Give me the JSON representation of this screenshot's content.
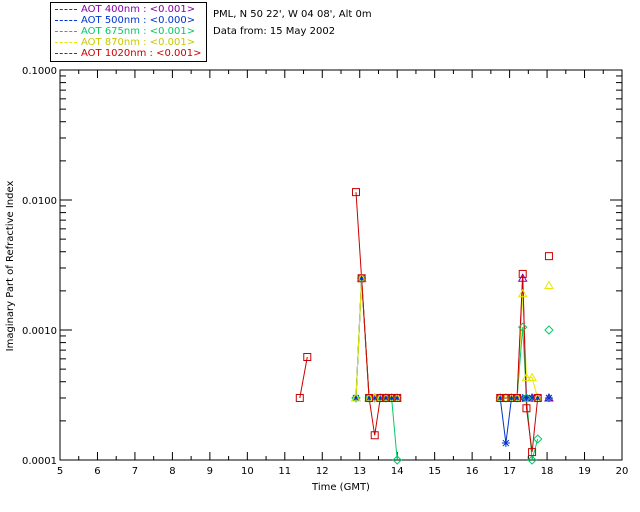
{
  "header": {
    "site": "PML, N 50 22', W 04 08', Alt 0m",
    "date": "Data from: 15 May 2002"
  },
  "legend": [
    {
      "label": "AOT  400nm : <0.001>",
      "color": "#8800aa"
    },
    {
      "label": "AOT  500nm : <0.000>",
      "color": "#0033cc"
    },
    {
      "label": "AOT  675nm : <0.001>",
      "color": "#00cc66"
    },
    {
      "label": "AOT  870nm : <0.001>",
      "color": "#e8e800"
    },
    {
      "label": "AOT 1020nm : <0.001>",
      "color": "#cc0000"
    }
  ],
  "chart_data": {
    "type": "line",
    "xlabel": "Time (GMT)",
    "ylabel": "Imaginary Part of Refractive Index",
    "xlim": [
      5,
      20
    ],
    "ylim": [
      0.0001,
      0.1
    ],
    "yscale": "log",
    "xticks": [
      5,
      6,
      7,
      8,
      9,
      10,
      11,
      12,
      13,
      14,
      15,
      16,
      17,
      18,
      19,
      20
    ],
    "yticks": [
      0.0001,
      0.001,
      0.01,
      0.1
    ],
    "ytick_labels": [
      "0.0001",
      "0.0010",
      "0.0100",
      "0.1000"
    ],
    "grid": false,
    "legend_position": "top-left, outside",
    "series": [
      {
        "name": "AOT  400nm : <0.001>",
        "color": "#8800aa",
        "marker": "triangle",
        "segments": [
          [
            [
              12.9,
              0.0003
            ],
            [
              13.05,
              0.0025
            ],
            [
              13.25,
              0.0003
            ],
            [
              13.4,
              0.0003
            ],
            [
              13.55,
              0.0003
            ],
            [
              13.7,
              0.0003
            ],
            [
              13.85,
              0.0003
            ],
            [
              14.0,
              0.0003
            ]
          ],
          [
            [
              16.75,
              0.0003
            ],
            [
              16.9,
              0.0003
            ],
            [
              17.05,
              0.0003
            ],
            [
              17.2,
              0.0003
            ],
            [
              17.35,
              0.0025
            ],
            [
              17.45,
              0.0003
            ],
            [
              17.6,
              0.0003
            ],
            [
              17.75,
              0.0003
            ]
          ]
        ],
        "points": [
          [
            18.05,
            0.0003
          ]
        ]
      },
      {
        "name": "AOT  500nm : <0.000>",
        "color": "#0033cc",
        "marker": "asterisk",
        "segments": [
          [
            [
              12.9,
              0.0003
            ],
            [
              13.05,
              0.0025
            ],
            [
              13.25,
              0.0003
            ],
            [
              13.4,
              0.0003
            ],
            [
              13.55,
              0.0003
            ],
            [
              13.7,
              0.0003
            ],
            [
              13.85,
              0.0003
            ],
            [
              14.0,
              0.0003
            ]
          ],
          [
            [
              16.75,
              0.0003
            ],
            [
              16.9,
              0.000135
            ],
            [
              17.05,
              0.0003
            ],
            [
              17.2,
              0.0003
            ],
            [
              17.35,
              0.0003
            ],
            [
              17.45,
              0.0003
            ],
            [
              17.6,
              0.0003
            ],
            [
              17.75,
              0.0003
            ]
          ]
        ],
        "points": [
          [
            18.05,
            0.0003
          ]
        ]
      },
      {
        "name": "AOT  675nm : <0.001>",
        "color": "#00cc66",
        "marker": "diamond",
        "segments": [
          [
            [
              12.9,
              0.0003
            ],
            [
              13.05,
              0.0025
            ],
            [
              13.25,
              0.0003
            ],
            [
              13.4,
              0.0003
            ],
            [
              13.55,
              0.0003
            ],
            [
              13.7,
              0.0003
            ],
            [
              13.85,
              0.0003
            ],
            [
              14.0,
              0.0001
            ]
          ],
          [
            [
              16.75,
              0.0003
            ],
            [
              16.9,
              0.0003
            ],
            [
              17.05,
              0.0003
            ],
            [
              17.2,
              0.0003
            ],
            [
              17.35,
              0.00105
            ],
            [
              17.45,
              0.0003
            ],
            [
              17.6,
              0.0001
            ],
            [
              17.75,
              0.000145
            ]
          ]
        ],
        "points": [
          [
            18.05,
            0.001
          ]
        ]
      },
      {
        "name": "AOT  870nm : <0.001>",
        "color": "#e8e800",
        "marker": "triangle",
        "segments": [
          [
            [
              12.9,
              0.0003
            ],
            [
              13.05,
              0.0025
            ],
            [
              13.25,
              0.0003
            ],
            [
              13.4,
              0.0003
            ],
            [
              13.55,
              0.0003
            ],
            [
              13.7,
              0.0003
            ],
            [
              13.85,
              0.0003
            ],
            [
              14.0,
              0.0003
            ]
          ],
          [
            [
              16.75,
              0.0003
            ],
            [
              16.9,
              0.0003
            ],
            [
              17.05,
              0.0003
            ],
            [
              17.2,
              0.0003
            ],
            [
              17.35,
              0.0019
            ],
            [
              17.45,
              0.00043
            ],
            [
              17.6,
              0.00043
            ],
            [
              17.75,
              0.0003
            ]
          ]
        ],
        "points": [
          [
            18.05,
            0.0022
          ]
        ]
      },
      {
        "name": "AOT 1020nm : <0.001>",
        "color": "#cc0000",
        "marker": "square",
        "segments": [
          [
            [
              11.4,
              0.0003
            ],
            [
              11.6,
              0.00062
            ]
          ],
          [
            [
              12.9,
              0.0115
            ],
            [
              13.05,
              0.0025
            ],
            [
              13.25,
              0.0003
            ],
            [
              13.4,
              0.000155
            ],
            [
              13.55,
              0.0003
            ],
            [
              13.7,
              0.0003
            ],
            [
              13.85,
              0.0003
            ],
            [
              14.0,
              0.0003
            ]
          ],
          [
            [
              16.75,
              0.0003
            ],
            [
              16.9,
              0.0003
            ],
            [
              17.05,
              0.0003
            ],
            [
              17.2,
              0.0003
            ],
            [
              17.35,
              0.0027
            ],
            [
              17.45,
              0.00025
            ],
            [
              17.6,
              0.000115
            ],
            [
              17.75,
              0.0003
            ]
          ]
        ],
        "points": [
          [
            18.05,
            0.0037
          ]
        ]
      }
    ]
  }
}
